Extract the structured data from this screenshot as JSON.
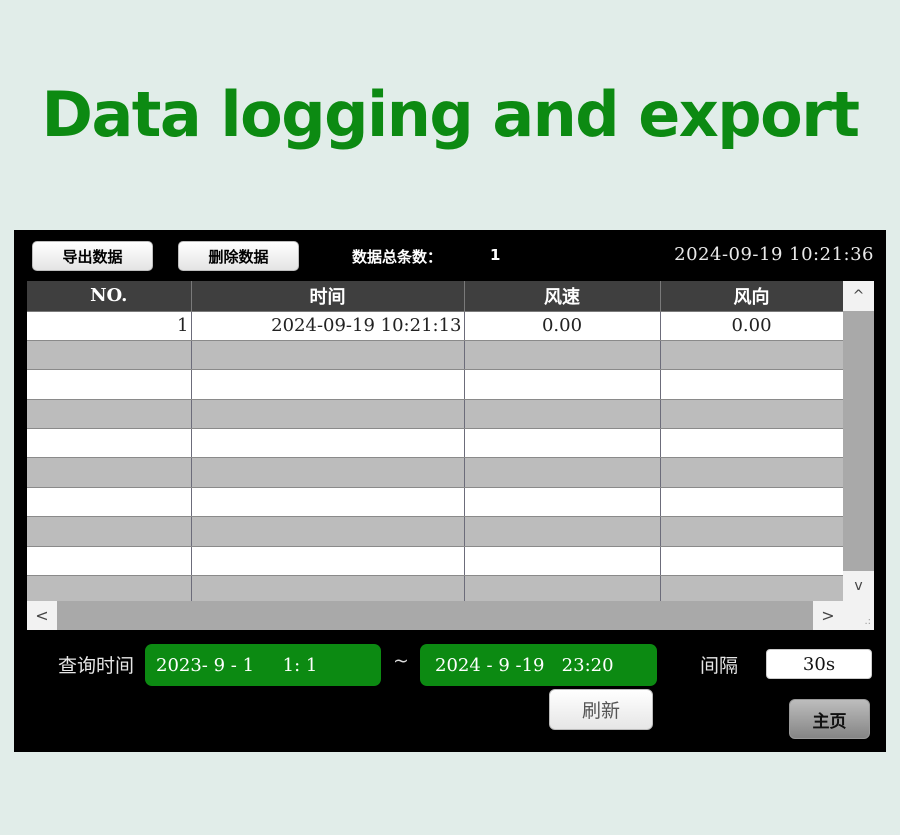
{
  "headline": "Data logging and export",
  "toolbar": {
    "export_label": "导出数据",
    "delete_label": "删除数据",
    "total_label": "数据总条数：",
    "total_value": "1",
    "clock": "2024-09-19  10:21:36"
  },
  "table": {
    "headers": [
      "NO.",
      "时间",
      "风速",
      "风向"
    ],
    "rows": [
      [
        "1",
        "2024-09-19 10:21:13",
        "0.00",
        "0.00"
      ],
      [
        "",
        "",
        "",
        ""
      ],
      [
        "",
        "",
        "",
        ""
      ],
      [
        "",
        "",
        "",
        ""
      ],
      [
        "",
        "",
        "",
        ""
      ],
      [
        "",
        "",
        "",
        ""
      ],
      [
        "",
        "",
        "",
        ""
      ],
      [
        "",
        "",
        "",
        ""
      ],
      [
        "",
        "",
        "",
        ""
      ],
      [
        "",
        "",
        "",
        ""
      ]
    ]
  },
  "scroll": {
    "up": "^",
    "down": "v",
    "left": "<",
    "right": ">",
    "grip": ".:"
  },
  "query": {
    "label": "查询时间",
    "start": "2023- 9 - 1     1: 1",
    "separator": "~",
    "end": "2024 - 9 -19   23:20",
    "interval_label": "间隔",
    "interval_value": "30s",
    "refresh_label": "刷新",
    "home_label": "主页"
  },
  "colors": {
    "accent_green": "#0c8a12",
    "header_dark": "#3f3f3f",
    "row_alt": "#bcbcbc"
  }
}
